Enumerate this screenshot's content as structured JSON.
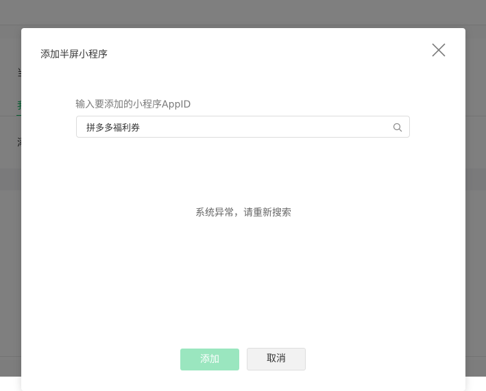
{
  "background": {
    "fragments": [
      "当",
      "我",
      "添"
    ]
  },
  "dialog": {
    "title": "添加半屏小程序",
    "close_icon": "close-icon",
    "field_label": "输入要添加的小程序AppID",
    "search": {
      "value": "拼多多福利券",
      "placeholder": "",
      "icon": "search-icon"
    },
    "status_message": "系统异常，请重新搜索",
    "buttons": {
      "add_label": "添加",
      "cancel_label": "取消"
    }
  },
  "colors": {
    "accent_green": "#07c160",
    "add_button_disabled": "#9ae6bf",
    "overlay": "rgba(0,0,0,0.5)"
  }
}
